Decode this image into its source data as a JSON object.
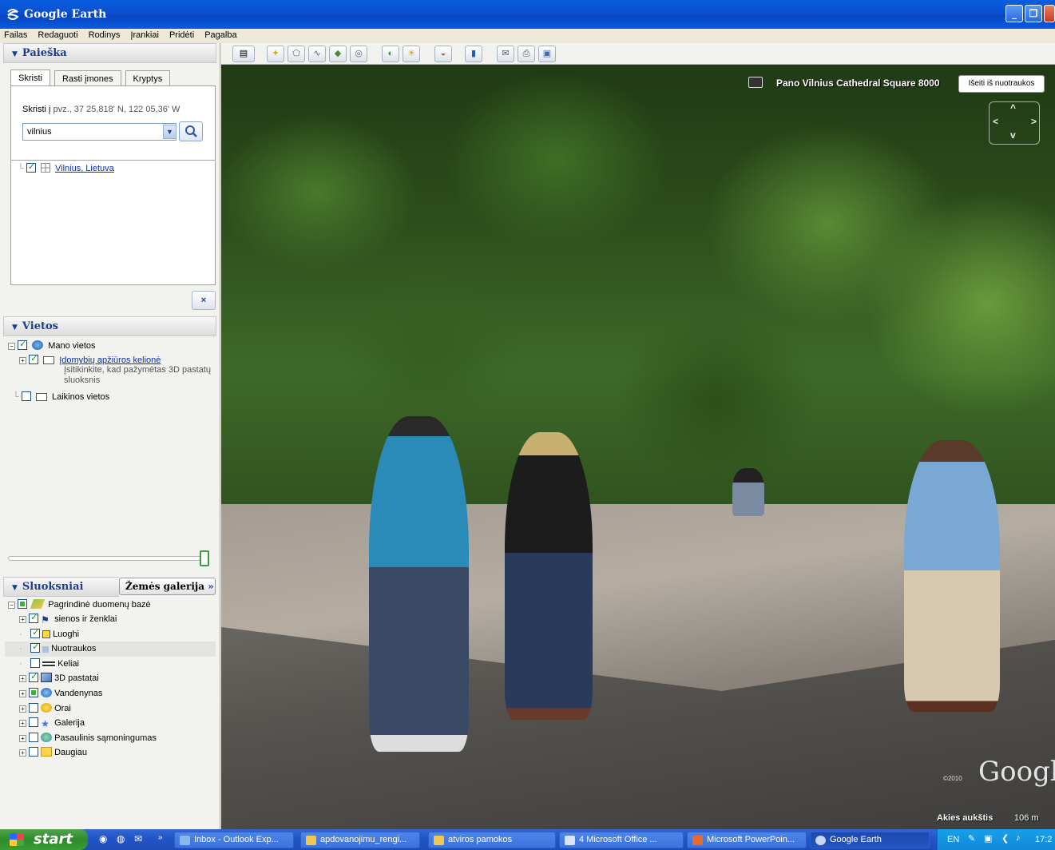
{
  "window": {
    "title": "Google Earth"
  },
  "menu": [
    "Failas",
    "Redaguoti",
    "Rodinys",
    "Įrankiai",
    "Pridėti",
    "Pagalba"
  ],
  "search_panel": {
    "header": "Paieška",
    "tabs": [
      "Skristi",
      "Rasti įmones",
      "Kryptys"
    ],
    "active_tab": "Skristi",
    "hint_prefix": "Skristi į",
    "hint_example": "pvz., 37 25,818' N, 122 05,36' W",
    "query": "vilnius",
    "result": "Vilnius, Lietuva",
    "clear_label": "×"
  },
  "places_panel": {
    "header": "Vietos",
    "my_places": "Mano vietos",
    "tour": "Įdomybių apžiūros kelionė",
    "tour_note_1": "Įsitikinkite, kad pažymėtas 3D pastatų",
    "tour_note_2": "sluoksnis",
    "temp_places": "Laikinos vietos"
  },
  "layers_panel": {
    "header": "Sluoksniai",
    "gallery_button": "Žemės galerija",
    "gallery_chevron": "»",
    "root": "Pagrindinė duomenų bazė",
    "items": [
      {
        "label": "sienos ir ženklai",
        "checked": true,
        "expandable": true,
        "icon": "flag-icon"
      },
      {
        "label": "Luoghi",
        "checked": true,
        "expandable": false,
        "icon": "place-icon"
      },
      {
        "label": "Nuotraukos",
        "checked": true,
        "expandable": false,
        "icon": "photo-icon",
        "selected": true
      },
      {
        "label": "Keliai",
        "checked": false,
        "expandable": false,
        "icon": "road-icon"
      },
      {
        "label": "3D pastatai",
        "checked": true,
        "expandable": true,
        "icon": "building-icon"
      },
      {
        "label": "Vandenynas",
        "checked": "partial",
        "expandable": true,
        "icon": "ocean-icon"
      },
      {
        "label": "Orai",
        "checked": false,
        "expandable": true,
        "icon": "sun-icon"
      },
      {
        "label": "Galerija",
        "checked": false,
        "expandable": true,
        "icon": "star-icon"
      },
      {
        "label": "Pasaulinis sąmoningumas",
        "checked": false,
        "expandable": true,
        "icon": "globe-icon"
      },
      {
        "label": "Daugiau",
        "checked": false,
        "expandable": true,
        "icon": "folder-icon"
      }
    ]
  },
  "view": {
    "pano_caption": "Pano Vilnius Cathedral Square 8000",
    "exit_button": "Išeiti iš nuotraukos",
    "google_logo": "Google",
    "copyright": "©2010",
    "eye_alt_label": "Akies aukštis",
    "eye_alt_value": "106 m"
  },
  "taskbar": {
    "start": "start",
    "tasks": [
      {
        "label": "Inbox - Outlook Exp...",
        "active": false
      },
      {
        "label": "apdovanojimu_rengi...",
        "active": false
      },
      {
        "label": "atviros pamokos",
        "active": false
      },
      {
        "label": "4 Microsoft Office ...",
        "active": false
      },
      {
        "label": "Microsoft PowerPoin...",
        "active": false
      },
      {
        "label": "Google Earth",
        "active": true
      }
    ],
    "lang": "EN",
    "clock": "17:2"
  },
  "colors": {
    "titlebar": "#0a5fe0",
    "taskbar": "#2456c8",
    "start": "#3a9e36",
    "link": "#0b2fb3"
  }
}
